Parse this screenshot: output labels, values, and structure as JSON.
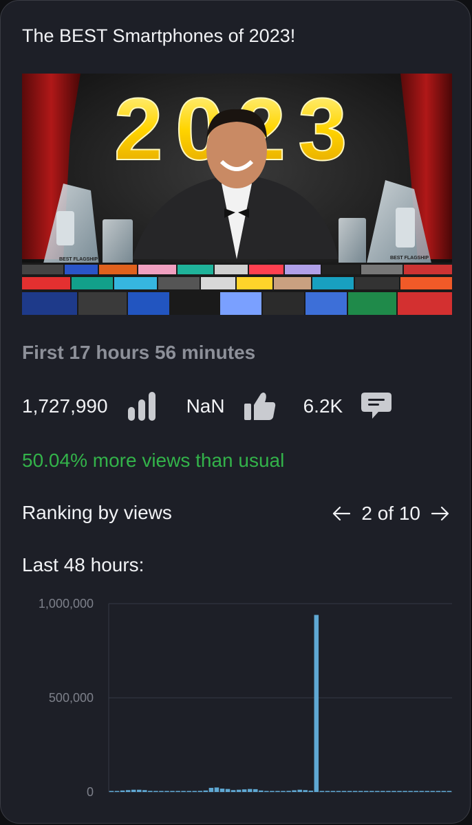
{
  "video": {
    "title": "The BEST Smartphones of 2023!",
    "thumbnail": {
      "headline_text": "2023",
      "trophy_label": "BEST FLAGSHIP"
    }
  },
  "period": {
    "label": "First 17 hours 56 minutes"
  },
  "stats": {
    "views": "1,727,990",
    "views_icon": "bar-chart-icon",
    "likes": "NaN",
    "likes_icon": "thumbs-up-icon",
    "comments": "6.2K",
    "comments_icon": "comment-icon"
  },
  "comparison": {
    "text": "50.04% more views than usual",
    "color": "#33b34a"
  },
  "ranking": {
    "label": "Ranking by views",
    "page_text": "2 of 10",
    "prev_icon": "arrow-left-icon",
    "next_icon": "arrow-right-icon"
  },
  "history": {
    "label": "Last 48 hours:"
  },
  "chart_data": {
    "type": "bar",
    "title": "",
    "xlabel": "",
    "ylabel": "",
    "ylim": [
      0,
      1000000
    ],
    "yticks": [
      0,
      500000,
      1000000
    ],
    "ytick_labels": [
      "0",
      "500,000",
      "1,000,000"
    ],
    "bar_color": "#5fa8d3",
    "grid": true,
    "values": [
      5000,
      5000,
      8000,
      10000,
      12000,
      12000,
      10000,
      6000,
      4000,
      3000,
      3000,
      3000,
      3000,
      3000,
      3000,
      5000,
      6000,
      8000,
      22000,
      24000,
      18000,
      16000,
      10000,
      12000,
      14000,
      16000,
      15000,
      8000,
      3000,
      3000,
      4000,
      5000,
      6000,
      9000,
      12000,
      10000,
      7000,
      940000,
      3000,
      3000,
      3000,
      3000,
      3000,
      3000,
      3000,
      3000,
      3000,
      3000,
      3000,
      3000,
      3000,
      3000,
      3000,
      3000,
      3000,
      3000,
      3000,
      3000,
      3000,
      3000,
      3000,
      3000
    ]
  }
}
